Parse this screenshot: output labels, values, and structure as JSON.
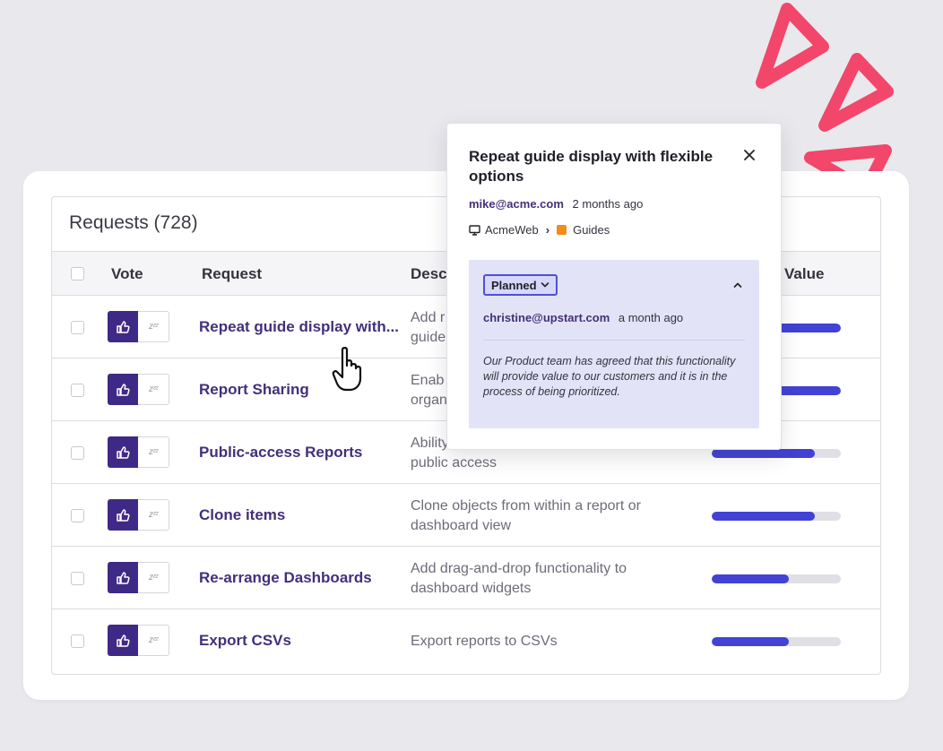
{
  "table": {
    "title": "Requests (728)",
    "columns": {
      "vote": "Vote",
      "request": "Request",
      "description": "Desc",
      "value": "Value"
    },
    "rows": [
      {
        "request": "Repeat guide display with...",
        "desc_line1": "Add r",
        "desc_line2": "guide",
        "value_fraction": 1.0
      },
      {
        "request": "Report Sharing",
        "desc_line1": "Enab",
        "desc_line2": "organ",
        "value_fraction": 1.0
      },
      {
        "request": "Public-access Reports",
        "desc_line1": "Ability",
        "desc_line2": "public access",
        "value_fraction": 0.8
      },
      {
        "request": "Clone items",
        "desc_line1": "Clone objects from within a report or",
        "desc_line2": "dashboard view",
        "value_fraction": 0.8
      },
      {
        "request": "Re-arrange Dashboards",
        "desc_line1": "Add drag-and-drop functionality to",
        "desc_line2": "dashboard widgets",
        "value_fraction": 0.6
      },
      {
        "request": "Export CSVs",
        "desc_line1": "Export reports to CSVs",
        "desc_line2": "",
        "value_fraction": 0.6
      }
    ],
    "snooze_glyph": "zᶻᶻ"
  },
  "popover": {
    "title": "Repeat guide display with flexible options",
    "author_email": "mike@acme.com",
    "author_time": "2 months ago",
    "product": "AcmeWeb",
    "crumb_separator": "›",
    "category": "Guides",
    "status": {
      "label": "Planned",
      "email": "christine@upstart.com",
      "time": "a month ago",
      "note": "Our Product team has agreed that this functionality will provide value to our customers and it is in the process of being prioritized."
    }
  },
  "colors": {
    "vote_purple": "#3e2a86",
    "link_purple": "#43307a",
    "bar_blue": "#4242d4",
    "status_panel": "#e3e3f8",
    "scribble_pink": "#f2476b",
    "category_orange": "#f38b16"
  },
  "icons": {
    "vote": "thumbs-up-icon",
    "snooze": "snooze-icon",
    "close": "close-icon",
    "monitor": "monitor-icon",
    "chevron": "chevron-down-icon",
    "collapse": "chevron-up-icon",
    "cursor": "hand-pointer-icon"
  }
}
